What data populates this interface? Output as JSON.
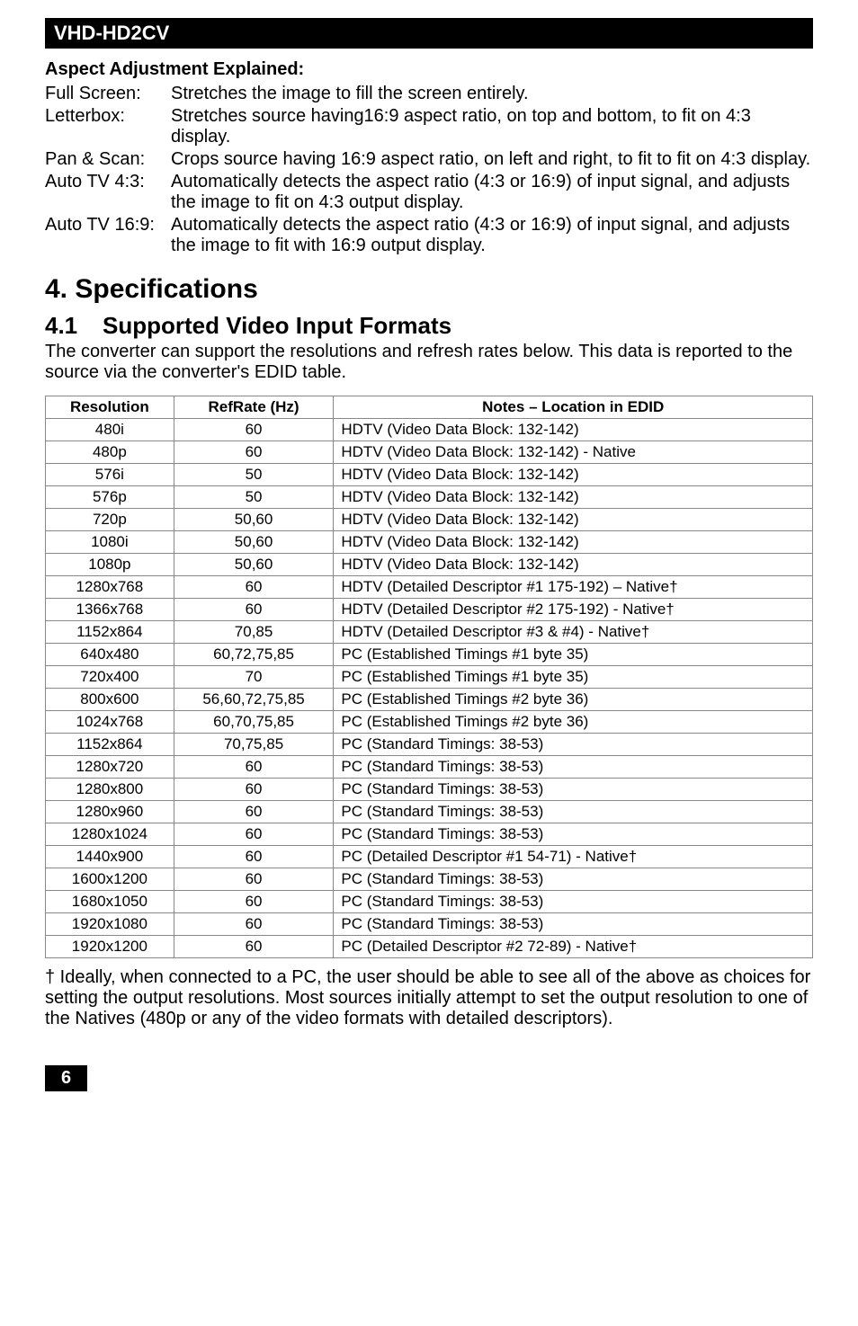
{
  "header": {
    "title": "VHD-HD2CV"
  },
  "aspect": {
    "heading": "Aspect Adjustment Explained:",
    "items": [
      {
        "label": "Full Screen:",
        "desc": "Stretches the image to fill the screen entirely."
      },
      {
        "label": "Letterbox:",
        "desc": "Stretches source having16:9 aspect ratio, on top and bottom, to fit on 4:3 display."
      },
      {
        "label": "Pan & Scan:",
        "desc": "Crops source having 16:9 aspect ratio, on left and right, to fit to fit on 4:3 display."
      },
      {
        "label": "Auto TV 4:3:",
        "desc": "Automatically detects the aspect ratio (4:3 or 16:9) of input signal, and adjusts the image to fit on 4:3 output display."
      },
      {
        "label": "Auto TV 16:9:",
        "desc": "Automatically detects the aspect ratio (4:3 or 16:9) of input signal, and adjusts the image to fit with 16:9 output display."
      }
    ]
  },
  "section_main": {
    "title": "4. Specifications"
  },
  "section_sub": {
    "num": "4.1",
    "title": "Supported Video Input Formats",
    "intro": "The converter can support the resolutions and refresh rates below. This data is reported to the source via the converter's EDID table."
  },
  "table": {
    "headers": [
      "Resolution",
      "RefRate (Hz)",
      "Notes – Location in EDID"
    ],
    "rows": [
      [
        "480i",
        "60",
        "HDTV (Video Data Block: 132-142)"
      ],
      [
        "480p",
        "60",
        "HDTV (Video Data Block: 132-142) - Native"
      ],
      [
        "576i",
        "50",
        "HDTV (Video Data Block: 132-142)"
      ],
      [
        "576p",
        "50",
        "HDTV (Video Data Block: 132-142)"
      ],
      [
        "720p",
        "50,60",
        "HDTV (Video Data Block: 132-142)"
      ],
      [
        "1080i",
        "50,60",
        "HDTV (Video Data Block: 132-142)"
      ],
      [
        "1080p",
        "50,60",
        "HDTV (Video Data Block: 132-142)"
      ],
      [
        "1280x768",
        "60",
        "HDTV (Detailed Descriptor #1 175-192) – Native†"
      ],
      [
        "1366x768",
        "60",
        "HDTV (Detailed Descriptor #2 175-192) - Native†"
      ],
      [
        "1152x864",
        "70,85",
        "HDTV (Detailed Descriptor #3 & #4) - Native†"
      ],
      [
        "640x480",
        "60,72,75,85",
        "PC (Established Timings #1 byte 35)"
      ],
      [
        "720x400",
        "70",
        "PC (Established Timings #1 byte 35)"
      ],
      [
        "800x600",
        "56,60,72,75,85",
        "PC (Established Timings #2 byte 36)"
      ],
      [
        "1024x768",
        "60,70,75,85",
        "PC (Established Timings #2 byte 36)"
      ],
      [
        "1152x864",
        "70,75,85",
        "PC (Standard Timings: 38-53)"
      ],
      [
        "1280x720",
        "60",
        "PC (Standard Timings: 38-53)"
      ],
      [
        "1280x800",
        "60",
        "PC (Standard Timings: 38-53)"
      ],
      [
        "1280x960",
        "60",
        "PC (Standard Timings: 38-53)"
      ],
      [
        "1280x1024",
        "60",
        "PC (Standard Timings: 38-53)"
      ],
      [
        "1440x900",
        "60",
        "PC (Detailed Descriptor #1 54-71) - Native†"
      ],
      [
        "1600x1200",
        "60",
        "PC (Standard Timings: 38-53)"
      ],
      [
        "1680x1050",
        "60",
        "PC (Standard Timings: 38-53)"
      ],
      [
        "1920x1080",
        "60",
        "PC (Standard Timings: 38-53)"
      ],
      [
        "1920x1200",
        "60",
        "PC (Detailed Descriptor #2 72-89) - Native†"
      ]
    ]
  },
  "footnote": "† Ideally, when connected to a PC, the user should be able to see all of the above as choices for setting the output resolutions.  Most sources initially attempt to set the output resolution to one of the Natives (480p or any of the video formats with detailed descriptors).",
  "page": {
    "num": "6"
  }
}
